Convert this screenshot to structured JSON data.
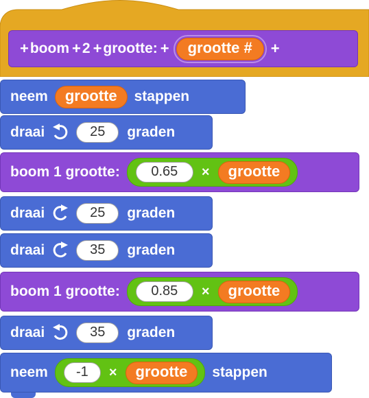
{
  "hat": {
    "plus": "+",
    "word_boom": "boom",
    "num": "2",
    "word_grootte": "grootte:",
    "param": "grootte #"
  },
  "blocks": [
    {
      "kind": "move",
      "pre": "neem",
      "var": "grootte",
      "post": "stappen"
    },
    {
      "kind": "turn_left",
      "pre": "draai",
      "value": "25",
      "post": "graden"
    },
    {
      "kind": "custom",
      "pre": "boom 1 grootte:",
      "value": "0.65",
      "times": "×",
      "var": "grootte"
    },
    {
      "kind": "turn_right",
      "pre": "draai",
      "value": "25",
      "post": "graden"
    },
    {
      "kind": "turn_right",
      "pre": "draai",
      "value": "35",
      "post": "graden"
    },
    {
      "kind": "custom",
      "pre": "boom 1 grootte:",
      "value": "0.85",
      "times": "×",
      "var": "grootte"
    },
    {
      "kind": "turn_left",
      "pre": "draai",
      "value": "35",
      "post": "graden"
    },
    {
      "kind": "move_expr",
      "pre": "neem",
      "value": "-1",
      "times": "×",
      "var": "grootte",
      "post": "stappen"
    }
  ],
  "colors": {
    "motion": "#4a6cd4",
    "custom": "#8e4ad6",
    "hat": "#e5a823",
    "variable": "#f37b22",
    "operator": "#62c213"
  }
}
